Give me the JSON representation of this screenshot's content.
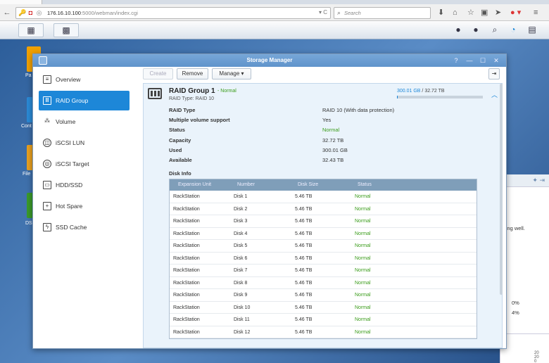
{
  "browser": {
    "url_host": "176.16.10.100",
    "url_path": ":5000/webman/index.cgi",
    "search_placeholder": "Search"
  },
  "desktop": {
    "icons": [
      {
        "label": "Pa",
        "color": "#f0a000"
      },
      {
        "label": "Cont",
        "color": "#2a8ad6"
      },
      {
        "label": "File",
        "color": "#e8a020"
      },
      {
        "label": "DS",
        "color": "#3a9a2a"
      }
    ],
    "bg_window": {
      "text_working": "king well.",
      "pct_1": "0%",
      "pct_2": "4%",
      "chart_ticks": [
        "20",
        "20",
        "0"
      ]
    }
  },
  "window": {
    "title": "Storage Manager",
    "controls": [
      "?",
      "—",
      "☐",
      "✕"
    ]
  },
  "sidebar": {
    "items": [
      {
        "label": "Overview",
        "icon": "overview-icon",
        "active": false
      },
      {
        "label": "RAID Group",
        "icon": "raid-group-icon",
        "active": true
      },
      {
        "label": "Volume",
        "icon": "volume-icon",
        "active": false
      },
      {
        "label": "iSCSI LUN",
        "icon": "iscsi-lun-icon",
        "active": false
      },
      {
        "label": "iSCSI Target",
        "icon": "iscsi-target-icon",
        "active": false
      },
      {
        "label": "HDD/SSD",
        "icon": "hdd-icon",
        "active": false
      },
      {
        "label": "Hot Spare",
        "icon": "hot-spare-icon",
        "active": false
      },
      {
        "label": "SSD Cache",
        "icon": "ssd-cache-icon",
        "active": false
      }
    ]
  },
  "toolbar": {
    "create_label": "Create",
    "remove_label": "Remove",
    "manage_label": "Manage ▾"
  },
  "raid_group": {
    "title": "RAID Group 1",
    "status_badge": "- Normal",
    "type_line": "RAID Type: RAID 10",
    "capacity_used": "300.01 GB",
    "capacity_sep": " / ",
    "capacity_total": "32.72 TB",
    "usage_fraction": 0.009,
    "properties": [
      {
        "label": "RAID Type",
        "value": "RAID 10 (With data protection)",
        "ok": false
      },
      {
        "label": "Multiple volume support",
        "value": "Yes",
        "ok": false
      },
      {
        "label": "Status",
        "value": "Normal",
        "ok": true
      },
      {
        "label": "Capacity",
        "value": "32.72 TB",
        "ok": false
      },
      {
        "label": "Used",
        "value": "300.01 GB",
        "ok": false
      },
      {
        "label": "Available",
        "value": "32.43 TB",
        "ok": false
      }
    ],
    "disk_info_label": "Disk Info",
    "disk_table": {
      "columns": [
        "Expansion Unit",
        "Number",
        "Disk Size",
        "Status"
      ],
      "rows": [
        [
          "RackStation",
          "Disk 1",
          "5.46 TB",
          "Normal"
        ],
        [
          "RackStation",
          "Disk 2",
          "5.46 TB",
          "Normal"
        ],
        [
          "RackStation",
          "Disk 3",
          "5.46 TB",
          "Normal"
        ],
        [
          "RackStation",
          "Disk 4",
          "5.46 TB",
          "Normal"
        ],
        [
          "RackStation",
          "Disk 5",
          "5.46 TB",
          "Normal"
        ],
        [
          "RackStation",
          "Disk 6",
          "5.46 TB",
          "Normal"
        ],
        [
          "RackStation",
          "Disk 7",
          "5.46 TB",
          "Normal"
        ],
        [
          "RackStation",
          "Disk 8",
          "5.46 TB",
          "Normal"
        ],
        [
          "RackStation",
          "Disk 9",
          "5.46 TB",
          "Normal"
        ],
        [
          "RackStation",
          "Disk 10",
          "5.46 TB",
          "Normal"
        ],
        [
          "RackStation",
          "Disk 11",
          "5.46 TB",
          "Normal"
        ],
        [
          "RackStation",
          "Disk 12",
          "5.46 TB",
          "Normal"
        ]
      ]
    }
  },
  "colors": {
    "accent": "#1d87d8",
    "status_ok": "#3a9c1a",
    "titlebar": "#6a9dd2"
  }
}
